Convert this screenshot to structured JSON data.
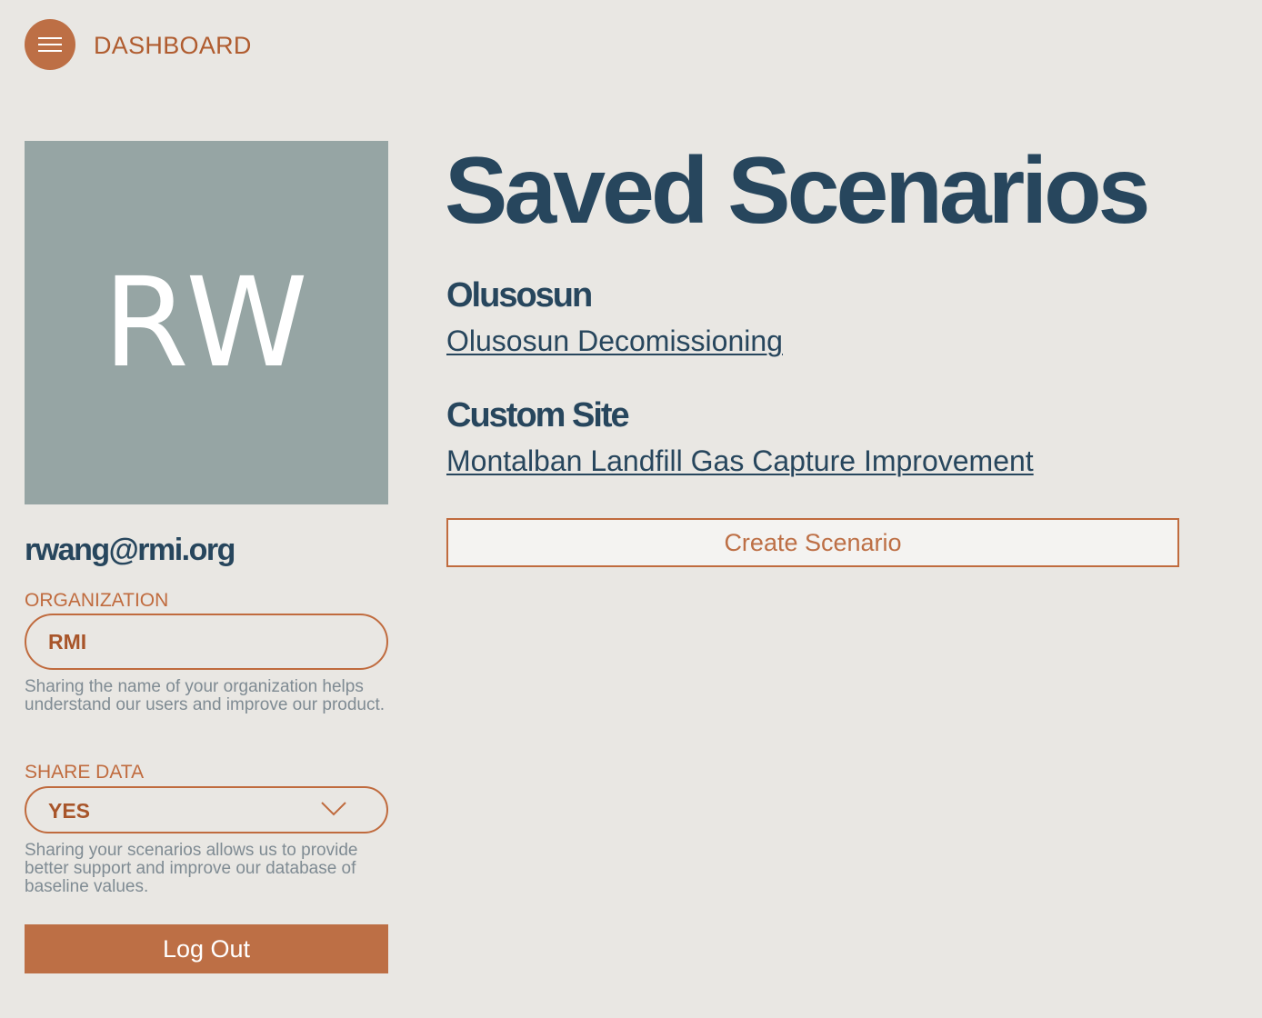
{
  "nav": {
    "title": "DASHBOARD",
    "menu_icon": "hamburger-menu-icon"
  },
  "profile": {
    "initials": "RW",
    "email": "rwang@rmi.org",
    "organization": {
      "label": "ORGANIZATION",
      "value": "RMI",
      "help": "Sharing the name of your organization helps understand our users and improve our product."
    },
    "share_data": {
      "label": "SHARE DATA",
      "value": "YES",
      "help": "Sharing your scenarios allows us to provide better support and improve our database of baseline values."
    },
    "logout_label": "Log Out"
  },
  "scenarios": {
    "title": "Saved Scenarios",
    "groups": [
      {
        "site": "Olusosun",
        "items": [
          "Olusosun Decomissioning"
        ]
      },
      {
        "site": "Custom Site",
        "items": [
          "Montalban Landfill Gas Capture Improvement"
        ]
      }
    ],
    "create_label": "Create Scenario"
  },
  "colors": {
    "background": "#e9e7e3",
    "accent": "#bd6f45",
    "navy": "#27465d",
    "avatar_bg": "#96a5a4"
  }
}
